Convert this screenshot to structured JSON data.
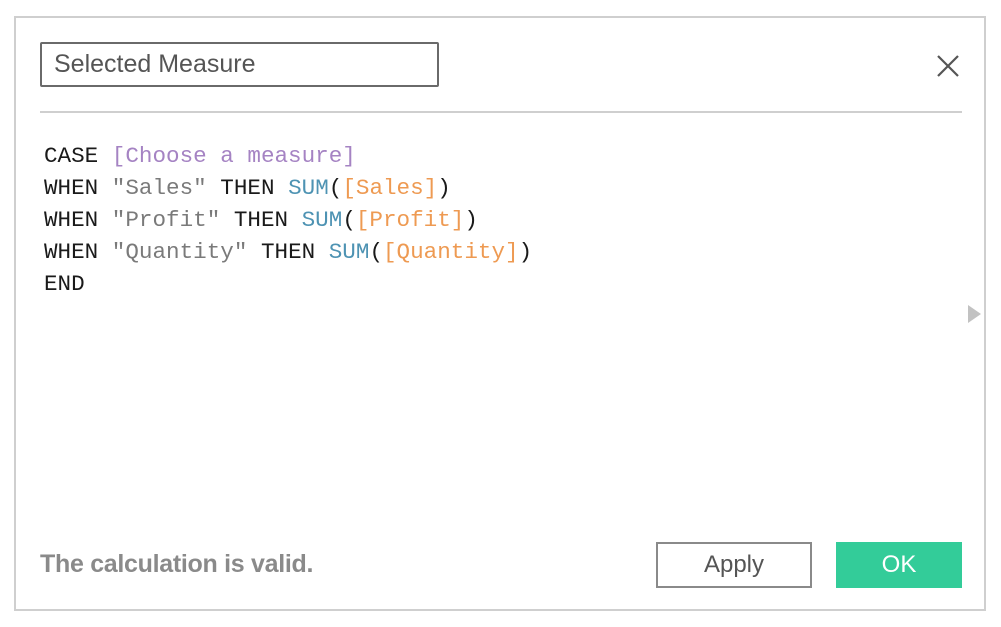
{
  "dialog": {
    "name_value": "Selected Measure",
    "close_icon": "close-icon",
    "expand_icon": "triangle-right-icon"
  },
  "formula": {
    "lines": [
      [
        {
          "type": "kw",
          "text": "CASE "
        },
        {
          "type": "param",
          "text": "[Choose a measure]"
        }
      ],
      [
        {
          "type": "kw",
          "text": "WHEN "
        },
        {
          "type": "str",
          "text": "\"Sales\""
        },
        {
          "type": "kw",
          "text": " THEN "
        },
        {
          "type": "fn",
          "text": "SUM"
        },
        {
          "type": "kw",
          "text": "("
        },
        {
          "type": "field",
          "text": "[Sales]"
        },
        {
          "type": "kw",
          "text": ")"
        }
      ],
      [
        {
          "type": "kw",
          "text": "WHEN "
        },
        {
          "type": "str",
          "text": "\"Profit\""
        },
        {
          "type": "kw",
          "text": " THEN "
        },
        {
          "type": "fn",
          "text": "SUM"
        },
        {
          "type": "kw",
          "text": "("
        },
        {
          "type": "field",
          "text": "[Profit]"
        },
        {
          "type": "kw",
          "text": ")"
        }
      ],
      [
        {
          "type": "kw",
          "text": "WHEN "
        },
        {
          "type": "str",
          "text": "\"Quantity\""
        },
        {
          "type": "kw",
          "text": " THEN "
        },
        {
          "type": "fn",
          "text": "SUM"
        },
        {
          "type": "kw",
          "text": "("
        },
        {
          "type": "field",
          "text": "[Quantity]"
        },
        {
          "type": "kw",
          "text": ")"
        }
      ],
      [
        {
          "type": "kw",
          "text": "END"
        }
      ]
    ]
  },
  "footer": {
    "status": "The calculation is valid.",
    "apply_label": "Apply",
    "ok_label": "OK"
  },
  "colors": {
    "ok_button": "#33cc99",
    "keyword": "#1a1a1a",
    "parameter": "#a583c3",
    "string": "#7a7a7a",
    "function": "#4e93b3",
    "field": "#ee9a52"
  }
}
